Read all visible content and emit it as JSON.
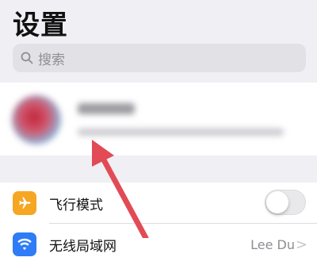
{
  "header": {
    "title": "设置"
  },
  "search": {
    "placeholder": "搜索",
    "icon": "search-icon"
  },
  "profile": {
    "blurred": true
  },
  "settings": {
    "airplane_mode": {
      "label": "飞行模式",
      "icon": "airplane-icon",
      "icon_color": "#f5a623",
      "toggle_on": false
    },
    "wifi": {
      "label": "无线局域网",
      "value": "Lee Du",
      "icon": "wifi-icon",
      "icon_color": "#2f7cf6",
      "chevron": ">"
    }
  },
  "annotation": {
    "arrow_color": "#e24a55"
  }
}
